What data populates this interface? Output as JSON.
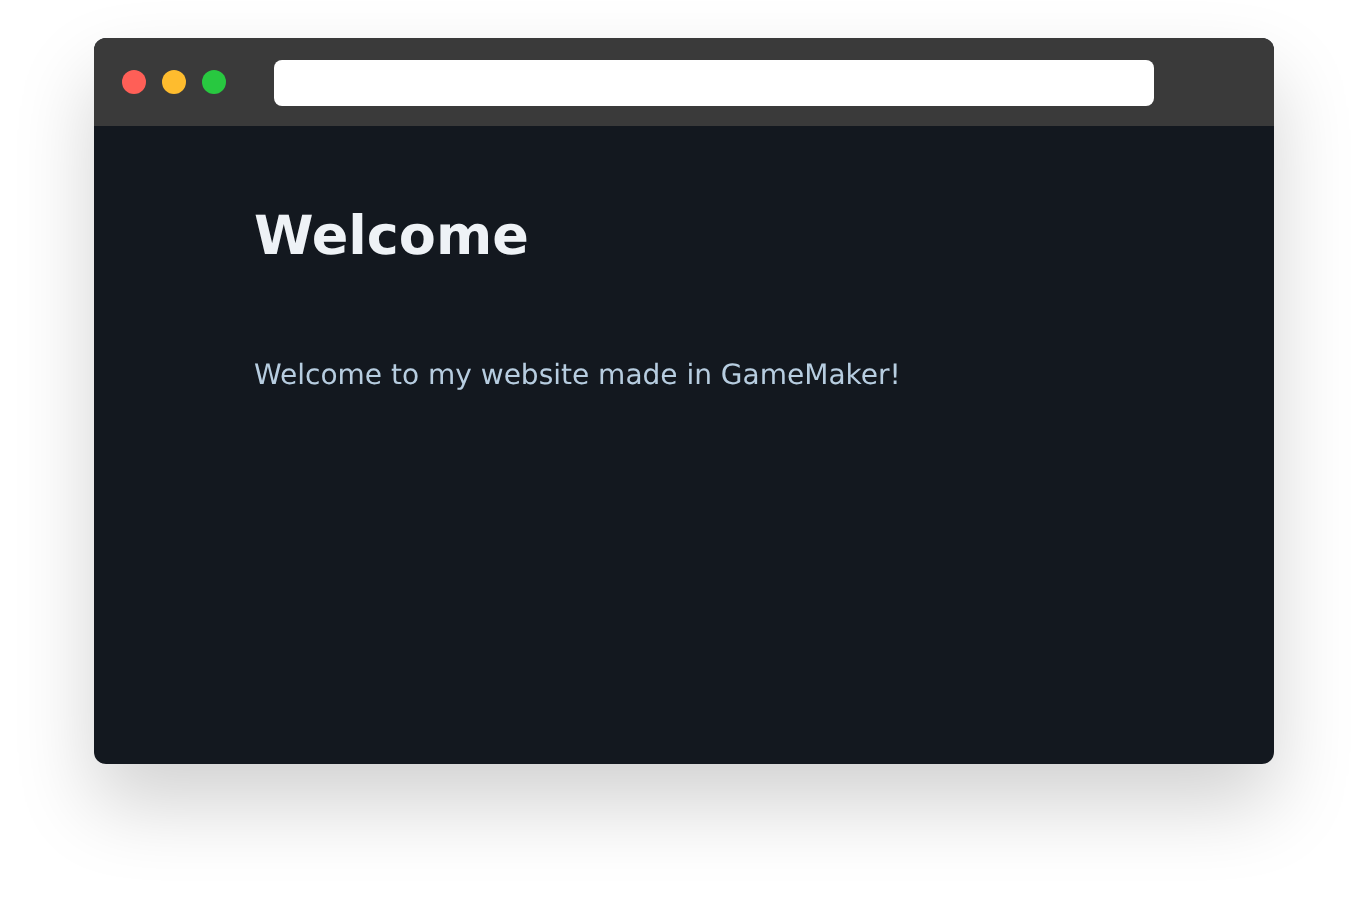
{
  "page": {
    "heading": "Welcome",
    "paragraph": "Welcome to my website made in GameMaker!"
  }
}
